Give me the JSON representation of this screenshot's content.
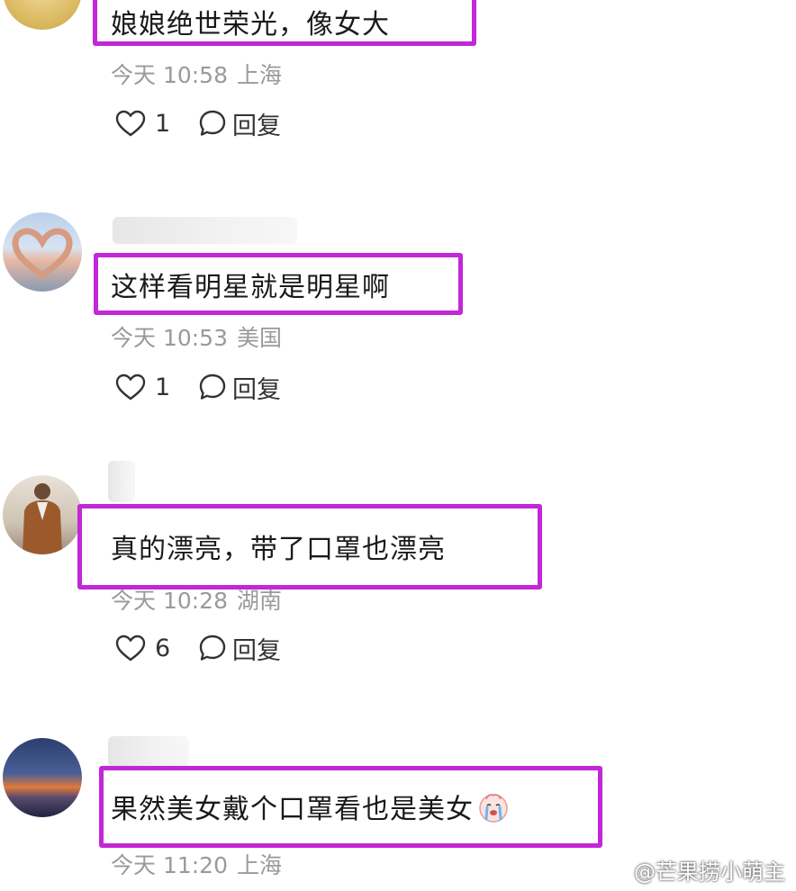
{
  "comments": [
    {
      "text": "娘娘绝世荣光，像女大",
      "time": "今天 10:58",
      "location": "上海",
      "likes": "1",
      "reply": "回复"
    },
    {
      "text": "这样看明星就是明星啊",
      "time": "今天 10:53",
      "location": "美国",
      "likes": "1",
      "reply": "回复"
    },
    {
      "text": "真的漂亮，带了口罩也漂亮",
      "time": "今天 10:28",
      "location": "湖南",
      "likes": "6",
      "reply": "回复"
    },
    {
      "text": "果然美女戴个口罩看也是美女",
      "time": "今天 11:20",
      "location": "上海",
      "emoji": "crying-face-emoji"
    }
  ],
  "watermark": "@芒果捞小萌主",
  "colors": {
    "highlight": "#c227d8",
    "meta": "#9a9a9a"
  }
}
